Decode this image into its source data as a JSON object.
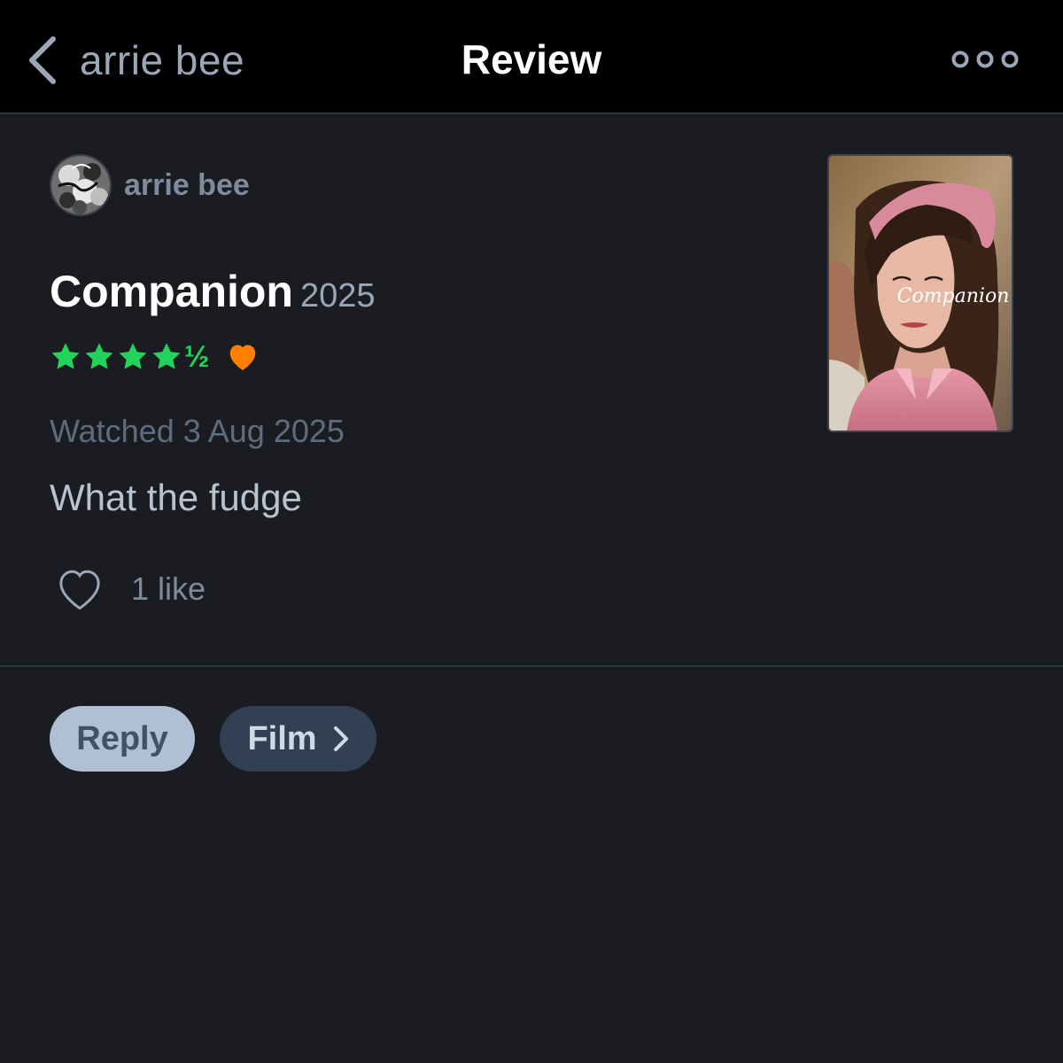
{
  "navbar": {
    "back_label": "arrie bee",
    "title": "Review"
  },
  "review": {
    "author": "arrie bee",
    "film_title": "Companion",
    "film_year": "2025",
    "rating": 4.5,
    "rating_half_glyph": "½",
    "liked": true,
    "watched": "Watched 3 Aug 2025",
    "text": "What the fudge",
    "likes": "1 like"
  },
  "poster": {
    "title_text": "Companion"
  },
  "actions": {
    "reply_label": "Reply",
    "film_label": "Film"
  },
  "icons": {
    "back": "chevron-left-icon",
    "more": "more-icon",
    "star": "star-icon",
    "liked_heart": "heart-filled-icon",
    "like": "heart-outline-icon",
    "film_chevron": "chevron-right-icon"
  },
  "colors": {
    "background": "#1a1c21",
    "navbar": "#000000",
    "star_green": "#22d35b",
    "heart_orange": "#ff8000",
    "reply_bg": "#afbfd4",
    "film_bg": "#324054"
  }
}
